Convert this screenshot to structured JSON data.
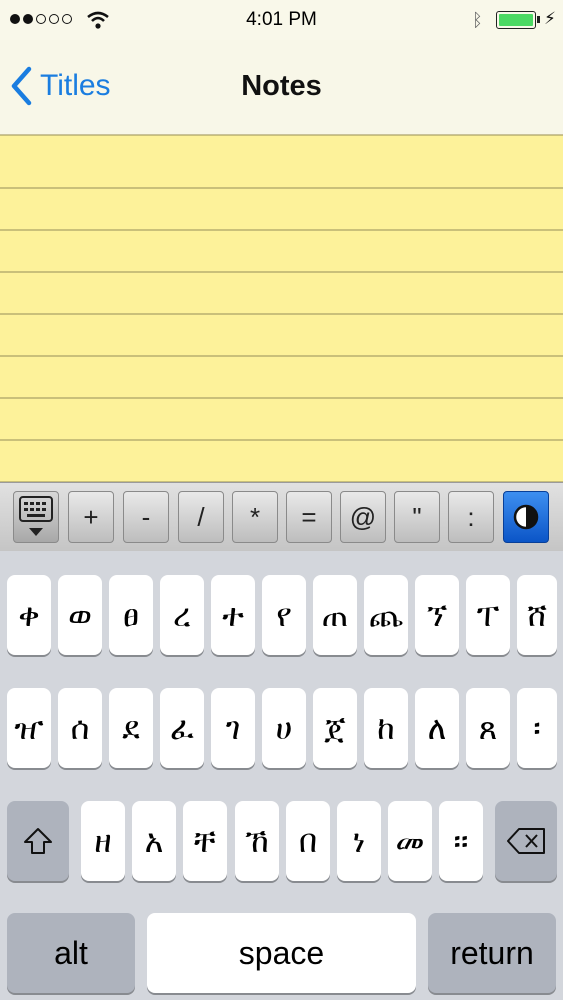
{
  "status_bar": {
    "time": "4:01 PM"
  },
  "nav": {
    "back_label": "Titles",
    "title": "Notes"
  },
  "toolbar": {
    "keys": [
      "+",
      "-",
      "/",
      "*",
      "=",
      "@",
      "\"",
      ":"
    ]
  },
  "keyboard": {
    "row1": [
      "ቀ",
      "ወ",
      "ፀ",
      "ረ",
      "ተ",
      "የ",
      "ጠ",
      "ጨ",
      "ኘ",
      "ፐ",
      "ሸ"
    ],
    "row2": [
      "ዠ",
      "ሰ",
      "ደ",
      "ፈ",
      "ገ",
      "ሀ",
      "ጀ",
      "ከ",
      "ለ",
      "ጸ",
      "፡"
    ],
    "row3": [
      "ዘ",
      "አ",
      "ቸ",
      "ኸ",
      "በ",
      "ነ",
      "መ",
      "።"
    ],
    "alt_label": "alt",
    "space_label": "space",
    "return_label": "return"
  },
  "colors": {
    "accent": "#1a7de0",
    "note_paper": "#fdf29a",
    "battery": "#4cd964"
  }
}
